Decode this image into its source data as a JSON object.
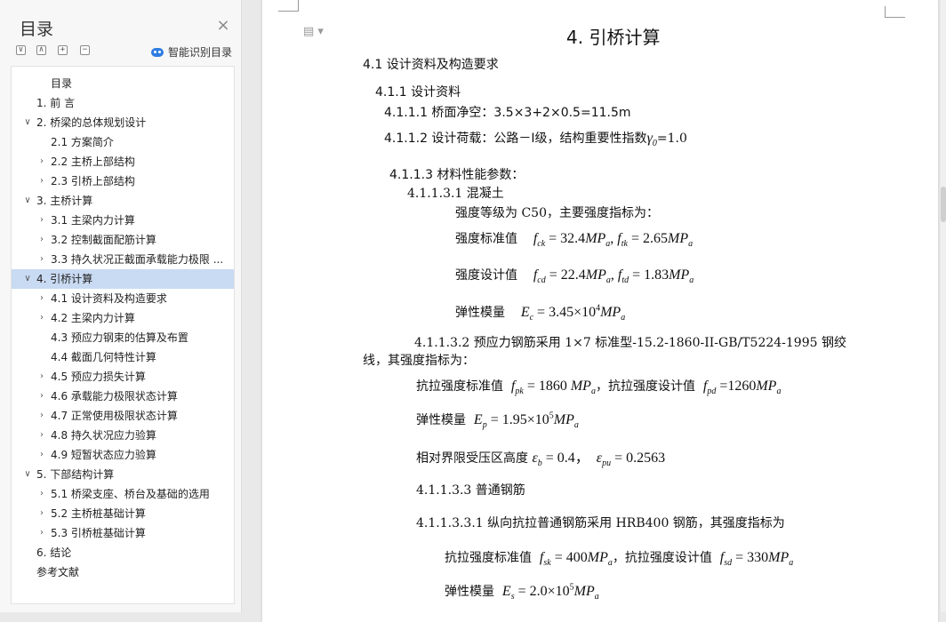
{
  "toc": {
    "title": "目录",
    "close": "×",
    "controls": [
      "∨",
      "∧",
      "+",
      "−"
    ],
    "smart_toc_label": "智能识别目录",
    "items": [
      {
        "label": "目录",
        "chevron": ""
      },
      {
        "label": "1.   前 言",
        "chevron": ""
      },
      {
        "label": "2.   桥梁的总体规划设计",
        "chevron": "∨"
      },
      {
        "label": "2.1  方案简介",
        "chevron": ""
      },
      {
        "label": "2.2  主桥上部结构",
        "chevron": "›"
      },
      {
        "label": "2.3  引桥上部结构",
        "chevron": "›"
      },
      {
        "label": "3.   主桥计算",
        "chevron": "∨"
      },
      {
        "label": "3.1  主梁内力计算",
        "chevron": "›"
      },
      {
        "label": "3.2  控制截面配筋计算",
        "chevron": "›"
      },
      {
        "label": "3.3  持久状况正截面承载能力极限 ...",
        "chevron": "›"
      },
      {
        "label": "4.   引桥计算",
        "chevron": "∨"
      },
      {
        "label": "4.1  设计资料及构造要求",
        "chevron": "›"
      },
      {
        "label": "4.2  主梁内力计算",
        "chevron": "›"
      },
      {
        "label": "4.3  预应力钢束的估算及布置",
        "chevron": ""
      },
      {
        "label": "4.4  截面几何特性计算",
        "chevron": ""
      },
      {
        "label": "4.5  预应力损失计算",
        "chevron": "›"
      },
      {
        "label": "4.6  承载能力极限状态计算",
        "chevron": "›"
      },
      {
        "label": "4.7  正常使用极限状态计算",
        "chevron": "›"
      },
      {
        "label": "4.8  持久状况应力验算",
        "chevron": "›"
      },
      {
        "label": "4.9  短暂状态应力验算",
        "chevron": "›"
      },
      {
        "label": "5.   下部结构计算",
        "chevron": "∨"
      },
      {
        "label": "5.1  桥梁支座、桥台及基础的选用",
        "chevron": "›"
      },
      {
        "label": "5.2  主桥桩基础计算",
        "chevron": "›"
      },
      {
        "label": "5.3  引桥桩基础计算",
        "chevron": "›"
      },
      {
        "label": "6.   结论",
        "chevron": ""
      },
      {
        "label": "参考文献",
        "chevron": ""
      }
    ]
  },
  "doc": {
    "page_icon": "▤ ▾",
    "heading": "4.   引桥计算",
    "h_41": "4.1  设计资料及构造要求",
    "h_411": "4.1.1 设计资料",
    "l_4111": "4.1.1.1 桥面净空：3.5×3+2×0.5=11.5m",
    "l_4112_a": "4.1.1.2 设计荷载：公路－Ⅰ级，结构重要性指数",
    "l_4112_gamma": "γ",
    "l_4112_sub": "0",
    "l_4112_b": "=1.0",
    "h_4113": "4.1.1.3 材料性能参数：",
    "h_41131": "4.1.1.3.1 混凝土",
    "concrete_grade": "强度等级为 C50，主要强度指标为：",
    "std_label": "强度标准值",
    "design_label": "强度设计值",
    "modulus_label": "弹性模量",
    "steel_line1": "4.1.1.3.2 预应力钢筋采用 1×7 标准型-15.2-1860-II-GB/T5224-1995 钢绞",
    "steel_line2": "线，其强度指标为：",
    "tensile_std_label": "抗拉强度标准值",
    "tensile_design_label": "，抗拉强度设计值",
    "xi_label": "相对界限受压区高度",
    "h_41133": "4.1.1.3.3 普通钢筋",
    "rebar_line": "4.1.1.3.3.1 纵向抗拉普通钢筋采用 HRB400 钢筋，其强度指标为",
    "math": {
      "fck": "f",
      "fck_sub": "ck",
      "fck_val": " = 32.4",
      "mp": "MP",
      "a": "a",
      "sep": ", ",
      "ftk": "f",
      "ftk_sub": "tk",
      "ftk_val": " = 2.65",
      "fcd": "f",
      "fcd_sub": "cd",
      "fcd_val": " = 22.4",
      "ftd": "f",
      "ftd_sub": "td",
      "ftd_val": " = 1.83",
      "ec": "E",
      "ec_sub": "c",
      "ec_val": " = 3.45×10",
      "ec_exp": "4",
      "fpk": "f",
      "fpk_sub": "pk",
      "fpk_val": " = 1860 ",
      "fpd": "f",
      "fpd_sub": "pd",
      "fpd_val": " =1260",
      "ep": "E",
      "ep_sub": "p",
      "ep_val": " = 1.95×10",
      "ep_exp": "5",
      "eb": "ε",
      "eb_sub": "b",
      "eb_val": " = 0.4，",
      "epu": "ε",
      "epu_sub": "pu",
      "epu_val": " = 0.2563",
      "fsk": "f",
      "fsk_sub": "sk",
      "fsk_val": " = 400",
      "fsd": "f",
      "fsd_sub": "sd",
      "fsd_val": " = 330",
      "es": "E",
      "es_sub": "s",
      "es_val": " = 2.0×10",
      "es_exp": "5"
    }
  }
}
